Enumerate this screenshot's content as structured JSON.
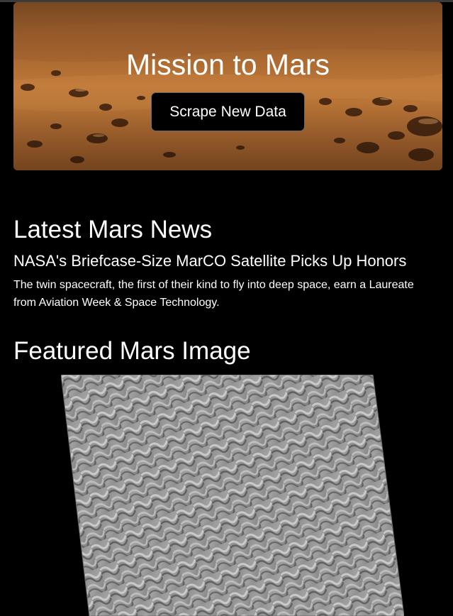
{
  "header": {
    "title": "Mission to Mars",
    "scrape_button_label": "Scrape New Data"
  },
  "news": {
    "heading": "Latest Mars News",
    "title": "NASA's Briefcase-Size MarCO Satellite Picks Up Honors",
    "teaser": "The twin spacecraft, the first of their kind to fly into deep space, earn a Laureate from Aviation Week & Space Technology."
  },
  "featured": {
    "heading": "Featured Mars Image"
  },
  "colors": {
    "background": "#000000",
    "text": "#ffffff",
    "button_bg": "#000000",
    "button_border": "#6a6a6a",
    "mars_surface": "#b06a2e"
  }
}
